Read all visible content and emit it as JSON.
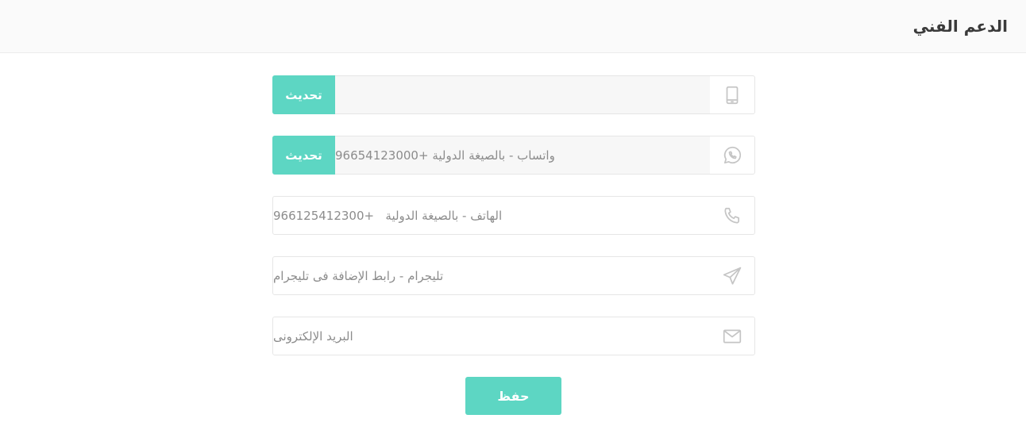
{
  "header": {
    "title": "الدعم الفني"
  },
  "fields": [
    {
      "name": "mobile",
      "icon": "tablet-icon",
      "value": "",
      "button_label": "تحديث"
    },
    {
      "name": "whatsapp",
      "icon": "whatsapp-icon",
      "value": "واتساب - بالصيغة الدولية +96654123000",
      "button_label": "تحديث"
    },
    {
      "name": "phone",
      "icon": "phone-icon",
      "value": "الهاتف - بالصيغة الدولية   +966125412300"
    },
    {
      "name": "telegram",
      "icon": "send-icon",
      "value": "تليجرام - رابط الإضافة فى تليجرام"
    },
    {
      "name": "email",
      "icon": "envelope-icon",
      "value": "البريد الإلكترونى"
    }
  ],
  "actions": {
    "save_label": "حفظ"
  },
  "colors": {
    "accent": "#5dd6c3",
    "header_bg": "#fafafa",
    "text_muted": "#8c8c8c",
    "icon": "#c5c5c5"
  }
}
